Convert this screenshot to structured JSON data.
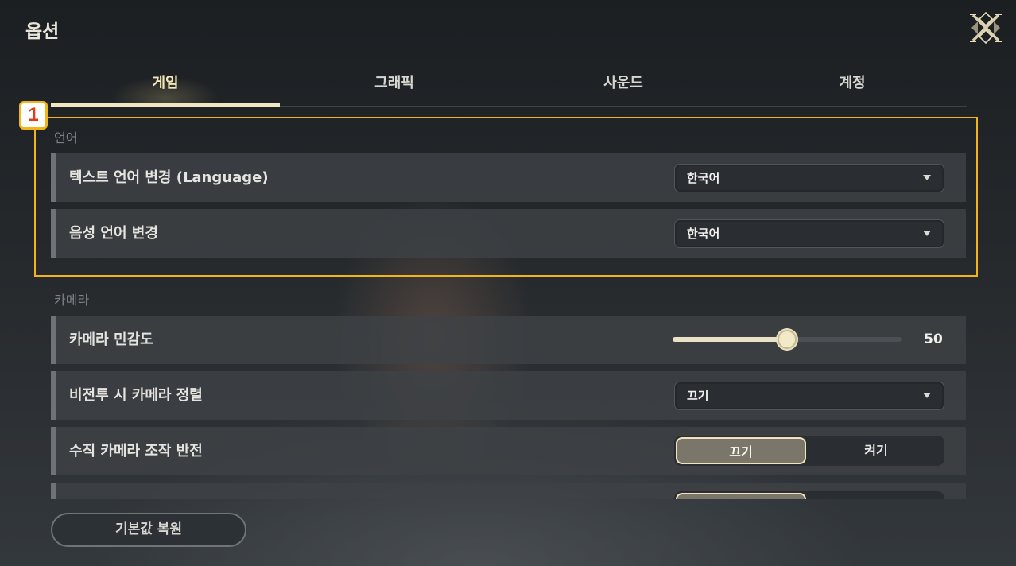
{
  "window": {
    "title": "옵션",
    "close_icon": "ornate-x-close-icon"
  },
  "tabs": [
    {
      "label": "게임",
      "active": true
    },
    {
      "label": "그래픽",
      "active": false
    },
    {
      "label": "사운드",
      "active": false
    },
    {
      "label": "계정",
      "active": false
    }
  ],
  "annotation": {
    "step_number": "1",
    "color": "#f2b417"
  },
  "sections": {
    "language": {
      "label": "언어",
      "rows": [
        {
          "label": "텍스트 언어 변경 (Language)",
          "value": "한국어"
        },
        {
          "label": "음성 언어 변경",
          "value": "한국어"
        }
      ]
    },
    "camera": {
      "label": "카메라",
      "sensitivity": {
        "label": "카메라 민감도",
        "value": "50",
        "level_fraction": 0.5
      },
      "battle_align": {
        "label": "비전투 시 카메라 정렬",
        "value": "끄기"
      },
      "invert_vertical": {
        "label": "수직 카메라 조작 반전",
        "option_off": "끄기",
        "option_on": "켜기",
        "selected": "끄기"
      }
    }
  },
  "footer": {
    "reset_label": "기본값 복원"
  },
  "colors": {
    "accent": "#f1e6c2",
    "highlight_box": "#f2b417",
    "badge_number": "#e43a1b"
  }
}
